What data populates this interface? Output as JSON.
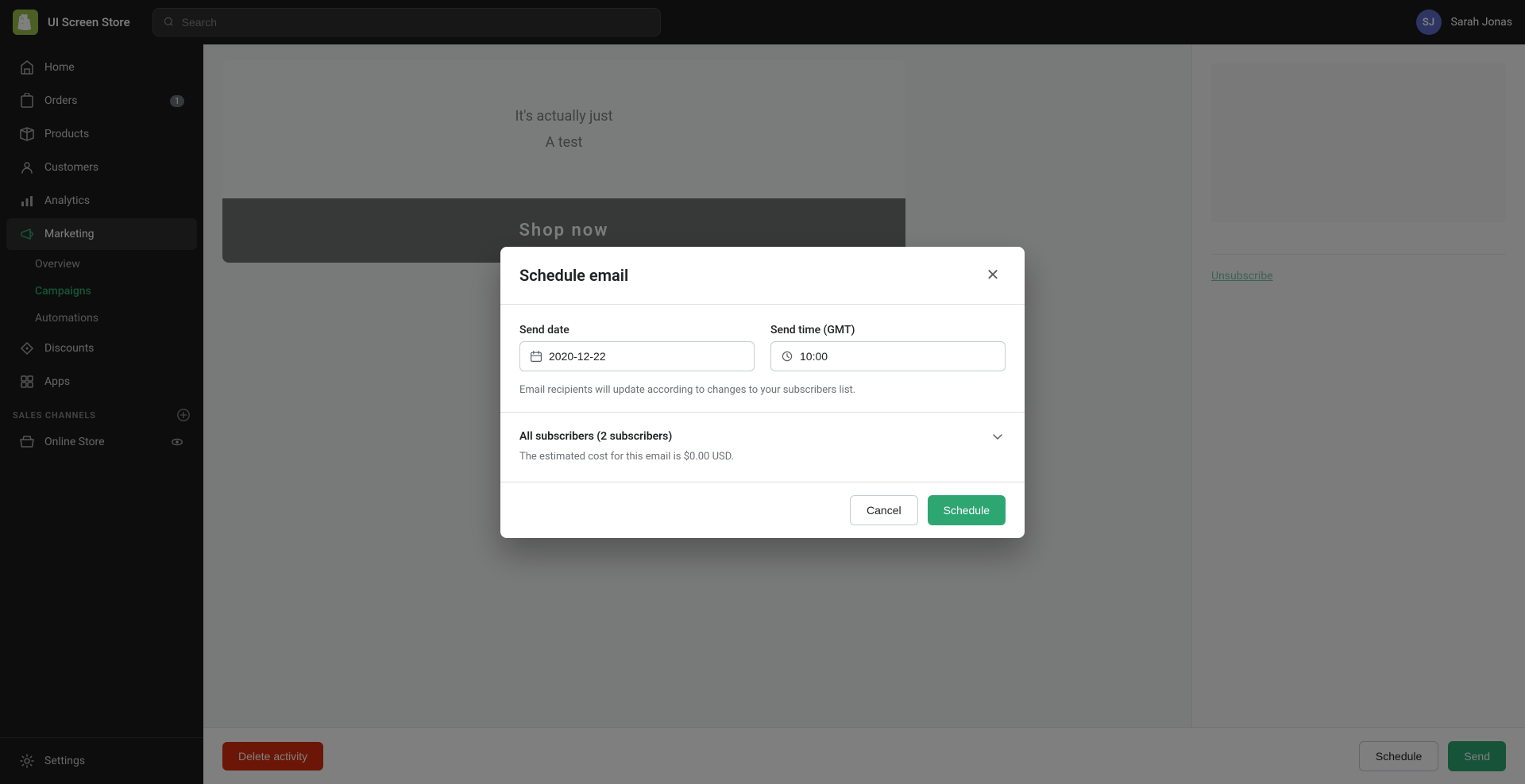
{
  "topbar": {
    "logo_alt": "Shopify logo",
    "store_name": "UI Screen Store",
    "search_placeholder": "Search",
    "user_initials": "SJ",
    "user_name": "Sarah Jonas"
  },
  "sidebar": {
    "items": [
      {
        "id": "home",
        "label": "Home",
        "icon": "home-icon",
        "badge": null
      },
      {
        "id": "orders",
        "label": "Orders",
        "icon": "orders-icon",
        "badge": "1"
      },
      {
        "id": "products",
        "label": "Products",
        "icon": "products-icon",
        "badge": null
      },
      {
        "id": "customers",
        "label": "Customers",
        "icon": "customers-icon",
        "badge": null
      },
      {
        "id": "analytics",
        "label": "Analytics",
        "icon": "analytics-icon",
        "badge": null
      },
      {
        "id": "marketing",
        "label": "Marketing",
        "icon": "marketing-icon",
        "badge": null,
        "active": true
      }
    ],
    "marketing_sub": [
      {
        "id": "overview",
        "label": "Overview"
      },
      {
        "id": "campaigns",
        "label": "Campaigns",
        "active": true
      },
      {
        "id": "automations",
        "label": "Automations"
      }
    ],
    "items2": [
      {
        "id": "discounts",
        "label": "Discounts",
        "icon": "discounts-icon"
      },
      {
        "id": "apps",
        "label": "Apps",
        "icon": "apps-icon"
      }
    ],
    "sales_channels_label": "SALES CHANNELS",
    "online_store_label": "Online Store",
    "settings_label": "Settings"
  },
  "modal": {
    "title": "Schedule email",
    "send_date_label": "Send date",
    "send_date_value": "2020-12-22",
    "send_time_label": "Send time (GMT)",
    "send_time_value": "10:00",
    "hint_text": "Email recipients will update according to changes to your subscribers list.",
    "subscribers_label": "All subscribers (2 subscribers)",
    "cost_text": "The estimated cost for this email is $0.00 USD.",
    "cancel_label": "Cancel",
    "schedule_label": "Schedule"
  },
  "bottom_bar": {
    "delete_label": "Delete activity",
    "schedule_label": "Schedule",
    "send_label": "Send"
  },
  "email_preview": {
    "line1": "It's actually just",
    "line2": "A test",
    "shop_now": "Shop now",
    "unsubscribe": "Unsubscribe"
  }
}
